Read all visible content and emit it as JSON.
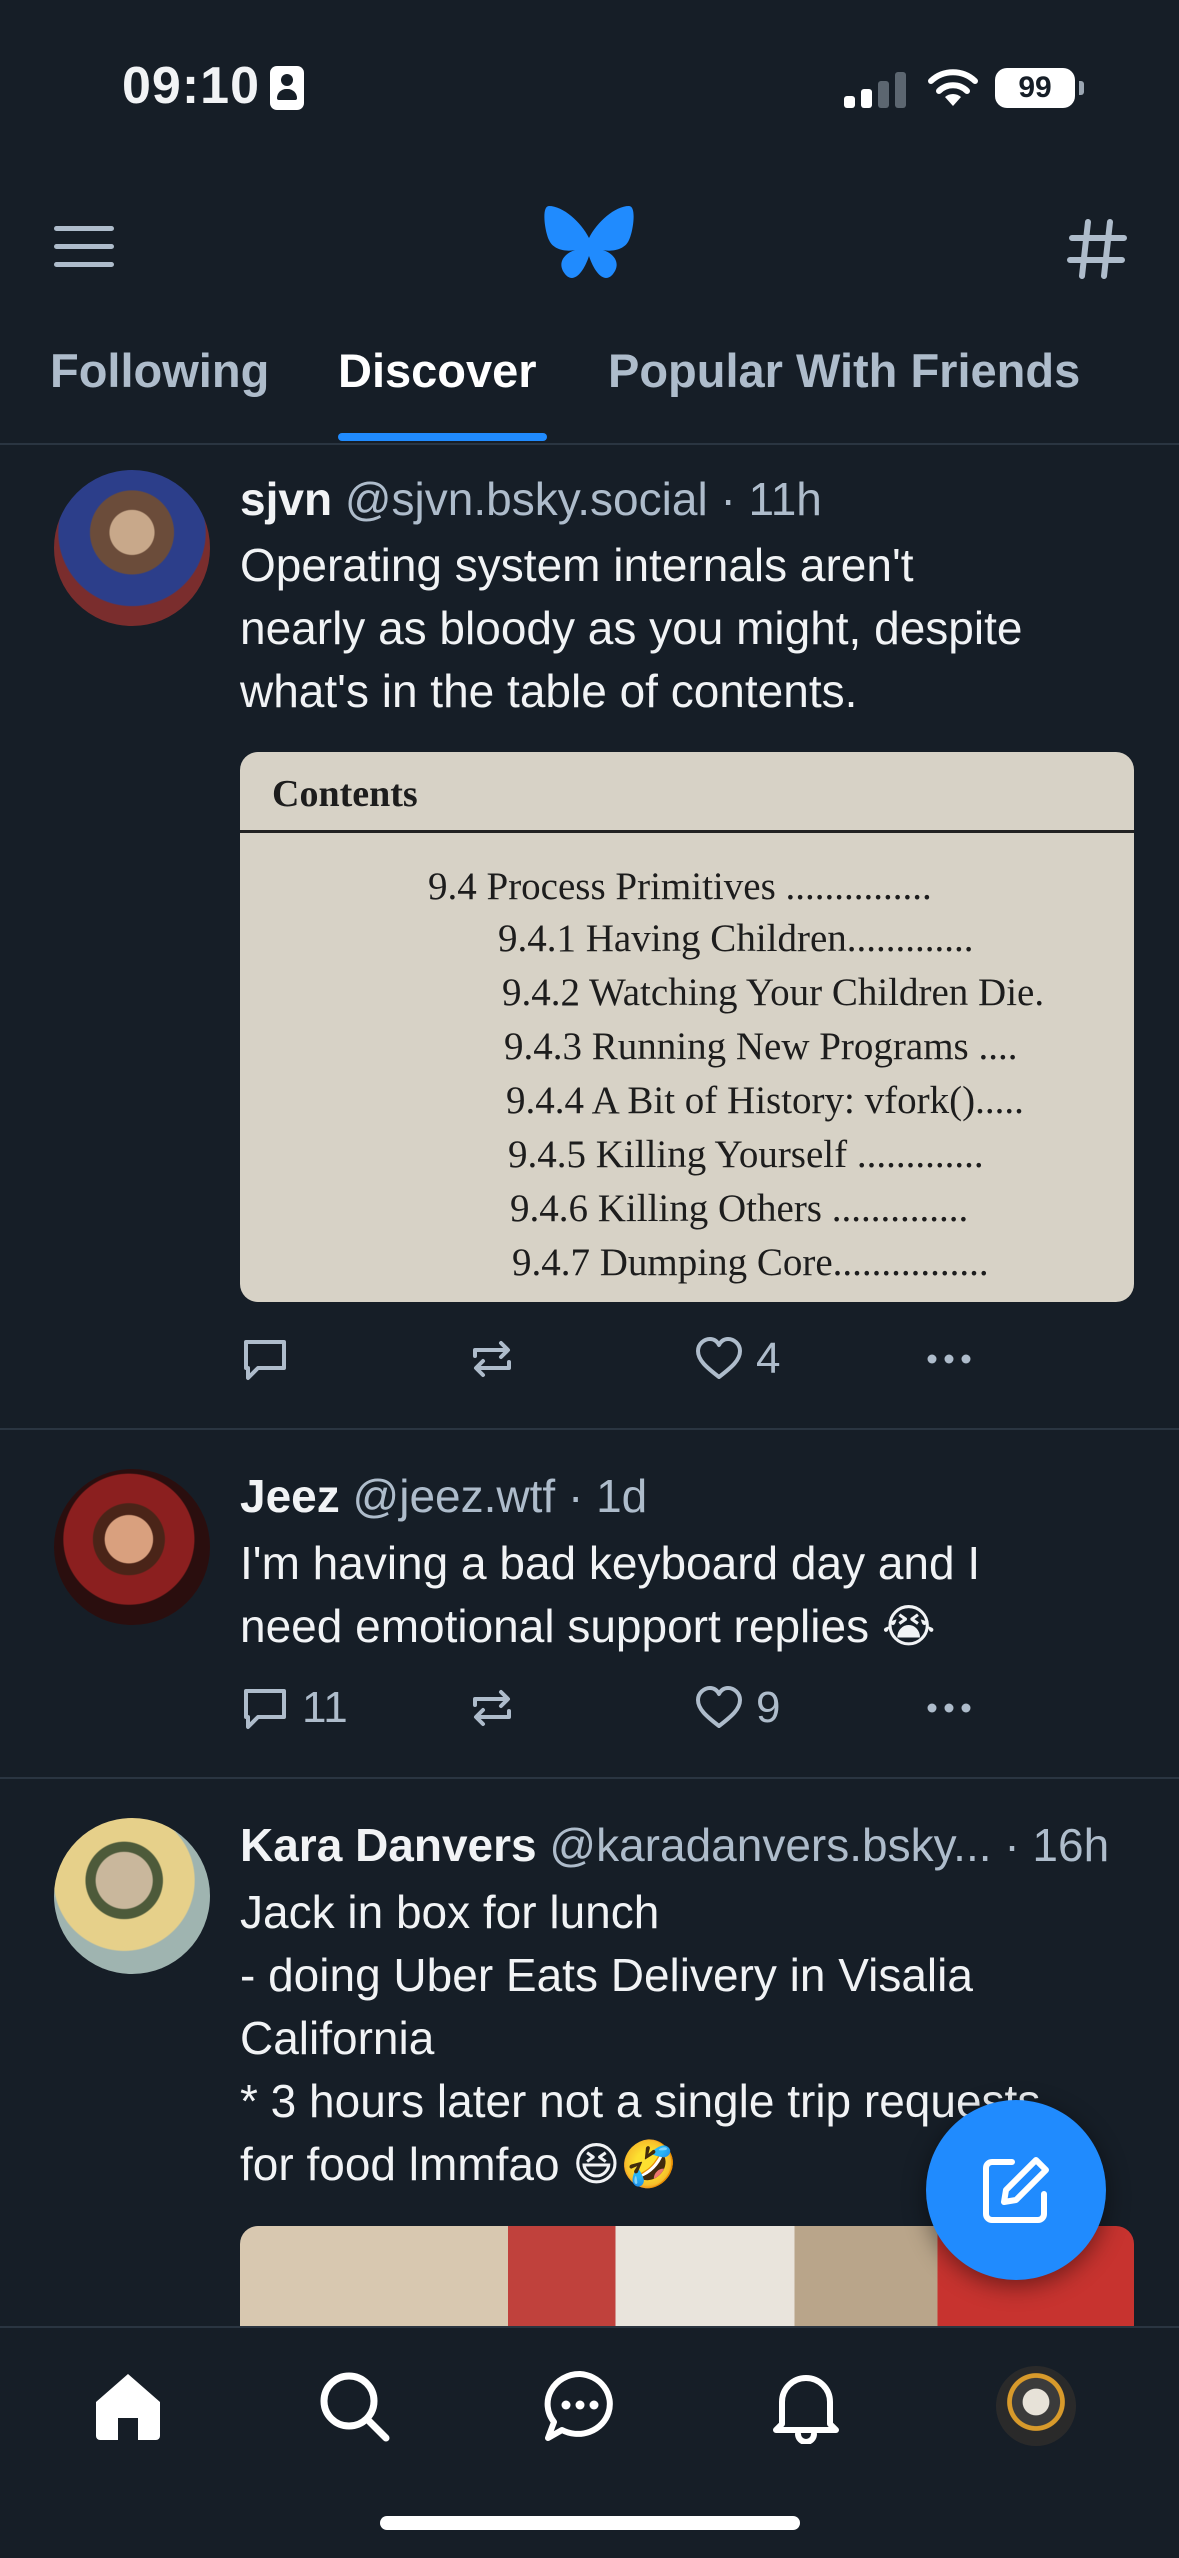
{
  "status_bar": {
    "time": "09:10",
    "battery": "99",
    "icons": [
      "id-card-icon",
      "cellular-signal-icon",
      "wifi-icon",
      "battery-icon"
    ]
  },
  "header": {
    "menu_icon": "hamburger-menu-icon",
    "logo_icon": "butterfly-logo-icon",
    "feeds_icon": "hashtag-icon",
    "tabs": [
      {
        "label": "Following",
        "active": false
      },
      {
        "label": "Discover",
        "active": true
      },
      {
        "label": "Popular With Friends",
        "active": false
      }
    ]
  },
  "posts": [
    {
      "display_name": "sjvn",
      "handle": "@sjvn.bsky.social",
      "time": "· 11h",
      "text": "Operating system internals aren't\nnearly as bloody as you might, despite\nwhat's in the table of contents.",
      "image": {
        "heading": "Contents",
        "lines": [
          "9.4 Process Primitives ...............",
          "9.4.1 Having Children.............",
          "9.4.2 Watching Your Children Die.",
          "9.4.3 Running New Programs ....",
          "9.4.4 A Bit of History: vfork().....",
          "9.4.5 Killing Yourself .............",
          "9.4.6 Killing Others ..............",
          "9.4.7 Dumping Core................"
        ]
      },
      "actions": {
        "replies": "",
        "reposts": "",
        "likes": "4"
      }
    },
    {
      "display_name": "Jeez",
      "handle": "@jeez.wtf",
      "time": "· 1d",
      "text": "I'm having a bad keyboard day and I\nneed emotional support replies 😭",
      "actions": {
        "replies": "11",
        "reposts": "",
        "likes": "9"
      }
    },
    {
      "display_name": "Kara Danvers",
      "handle": "@karadanvers.bsky...",
      "time": "· 16h",
      "text": "Jack in box for lunch\n- doing Uber Eats Delivery in Visalia\nCalifornia\n* 3 hours later not a single trip requests\nfor food lmmfao 😆🤣",
      "actions": {
        "replies": "",
        "reposts": "",
        "likes": ""
      }
    }
  ],
  "bottom_nav": {
    "items": [
      "home-icon",
      "search-icon",
      "chat-icon",
      "bell-icon",
      "profile-avatar"
    ]
  },
  "compose_button": {
    "icon": "compose-icon"
  },
  "colors": {
    "background": "#161e27",
    "accent": "#208bfe",
    "muted": "#aebccb"
  }
}
